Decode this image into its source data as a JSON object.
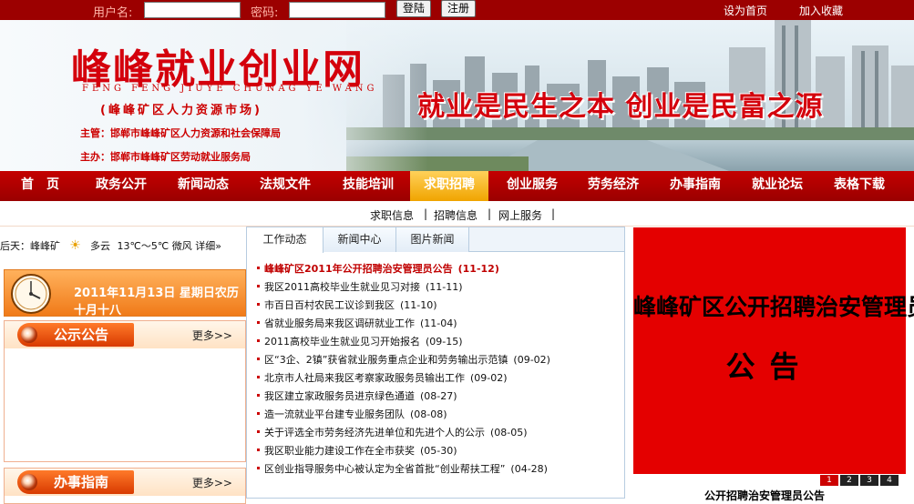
{
  "login": {
    "username_label": "用户名:",
    "password_label": "密码:",
    "login_button": "登陆",
    "register_button": "注册",
    "set_home": "设为首页",
    "add_favorite": "加入收藏"
  },
  "banner": {
    "title": "峰峰就业创业网",
    "pinyin": "FENG FENG JIUYE CHUNAG YE WANG",
    "subtitle": "(峰峰矿区人力资源市场)",
    "sponsor1": "主管：邯郸市峰峰矿区人力资源和社会保障局",
    "sponsor2": "主办：邯郸市峰峰矿区劳动就业服务局",
    "slogan": "就业是民生之本 创业是民富之源"
  },
  "nav": {
    "items": [
      "首　页",
      "政务公开",
      "新闻动态",
      "法规文件",
      "技能培训",
      "求职招聘",
      "创业服务",
      "劳务经济",
      "办事指南",
      "就业论坛",
      "表格下载"
    ],
    "active_index": 5
  },
  "subnav": [
    "求职信息",
    "|",
    "招聘信息",
    "|",
    "网上服务",
    "|"
  ],
  "weather": {
    "text": "后天：峰峰矿",
    "condition": "多云",
    "temp": "13℃～5℃ 微风",
    "detail": "详细»"
  },
  "date": {
    "solar": "2011年11月13日 星期日农历",
    "lunar": "十月十八"
  },
  "panels": {
    "notice_title": "公示公告",
    "notice_more": "更多>>",
    "guide_title": "办事指南",
    "guide_more": "更多>>"
  },
  "tabs": [
    "工作动态",
    "新闻中心",
    "图片新闻"
  ],
  "news": [
    {
      "title": "峰峰矿区2011年公开招聘治安管理员公告",
      "date": "(11-12)"
    },
    {
      "title": "我区2011高校毕业生就业见习对接",
      "date": "(11-11)"
    },
    {
      "title": "市百日百村农民工议诊到我区",
      "date": "(11-10)"
    },
    {
      "title": "省就业服务局来我区调研就业工作",
      "date": "(11-04)"
    },
    {
      "title": "2011高校毕业生就业见习开始报名",
      "date": "(09-15)"
    },
    {
      "title": "区“3企、2镇”获省就业服务重点企业和劳务输出示范镇",
      "date": "(09-02)"
    },
    {
      "title": "北京市人社局来我区考察家政服务员输出工作",
      "date": "(09-02)"
    },
    {
      "title": "我区建立家政服务员进京绿色通道",
      "date": "(08-27)"
    },
    {
      "title": "造一流就业平台建专业服务团队",
      "date": "(08-08)"
    },
    {
      "title": "关于评选全市劳务经济先进单位和先进个人的公示",
      "date": "(08-05)"
    },
    {
      "title": "我区职业能力建设工作在全市获奖",
      "date": "(05-30)"
    },
    {
      "title": "区创业指导服务中心被认定为全省首批“创业帮扶工程”",
      "date": "(04-28)"
    }
  ],
  "slide": {
    "line1": "峰峰矿区公开招聘治安管理员",
    "line2": "公告",
    "pages": [
      "1",
      "2",
      "3",
      "4"
    ],
    "caption": "公开招聘治安管理员公告"
  },
  "colors": {
    "brand_red": "#c40000",
    "accent_orange": "#f07a18",
    "nav_active": "#f0a400"
  }
}
